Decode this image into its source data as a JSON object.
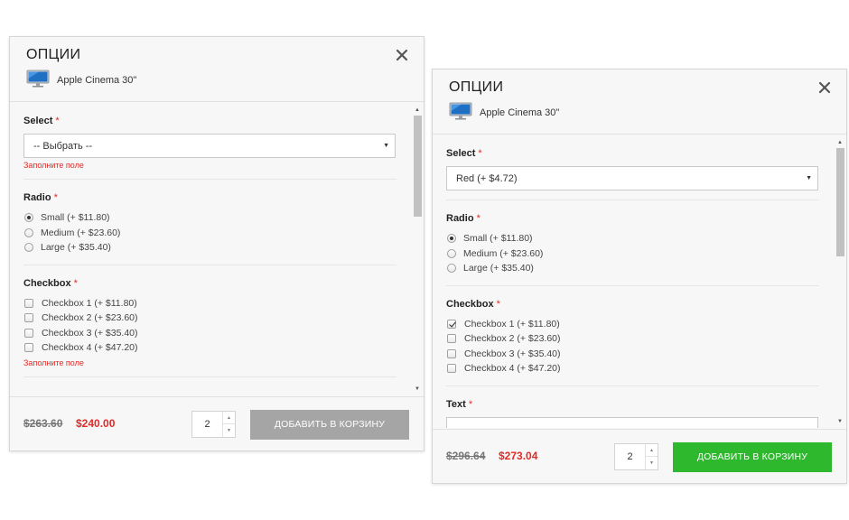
{
  "colors": {
    "accent_red": "#e02b27",
    "button_green": "#2eb82e",
    "button_disabled": "#a5a5a5"
  },
  "modal_a": {
    "title": "ОПЦИИ",
    "product_icon": "monitor-icon",
    "product_name": "Apple Cinema 30\"",
    "select": {
      "label": "Select",
      "required": "*",
      "value": "-- Выбрать --",
      "error": "Заполните поле"
    },
    "radio": {
      "label": "Radio",
      "required": "*",
      "options": [
        "Small (+ $11.80)",
        "Medium (+ $23.60)",
        "Large (+ $35.40)"
      ],
      "selected_index": 0
    },
    "checkbox": {
      "label": "Checkbox",
      "required": "*",
      "options": [
        "Checkbox 1 (+ $11.80)",
        "Checkbox 2 (+ $23.60)",
        "Checkbox 3 (+ $35.40)",
        "Checkbox 4 (+ $47.20)"
      ],
      "checked": [],
      "error": "Заполните поле"
    },
    "old_price": "$263.60",
    "new_price": "$240.00",
    "quantity": "2",
    "add_to_cart": "ДОБАВИТЬ В КОРЗИНУ"
  },
  "modal_b": {
    "title": "ОПЦИИ",
    "product_icon": "monitor-icon",
    "product_name": "Apple Cinema 30\"",
    "select": {
      "label": "Select",
      "required": "*",
      "value": "Red (+ $4.72)"
    },
    "radio": {
      "label": "Radio",
      "required": "*",
      "options": [
        "Small (+ $11.80)",
        "Medium (+ $23.60)",
        "Large (+ $35.40)"
      ],
      "selected_index": 0
    },
    "checkbox": {
      "label": "Checkbox",
      "required": "*",
      "options": [
        "Checkbox 1 (+ $11.80)",
        "Checkbox 2 (+ $23.60)",
        "Checkbox 3 (+ $35.40)",
        "Checkbox 4 (+ $47.20)"
      ],
      "checked": [
        0
      ]
    },
    "text": {
      "label": "Text",
      "required": "*"
    },
    "old_price": "$296.64",
    "new_price": "$273.04",
    "quantity": "2",
    "add_to_cart": "ДОБАВИТЬ В КОРЗИНУ"
  }
}
